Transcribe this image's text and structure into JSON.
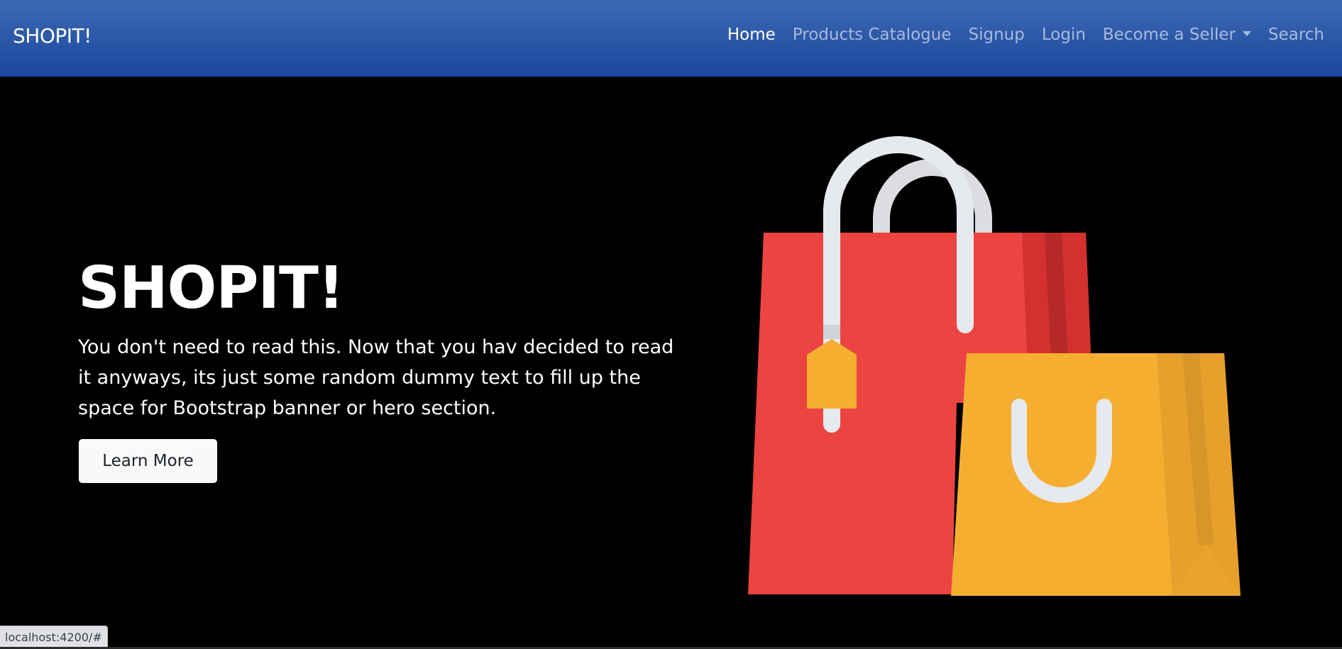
{
  "navbar": {
    "brand": "SHOPIT!",
    "links": [
      {
        "label": "Home",
        "active": true
      },
      {
        "label": "Products Catalogue",
        "active": false
      },
      {
        "label": "Signup",
        "active": false
      },
      {
        "label": "Login",
        "active": false
      },
      {
        "label": "Become a Seller",
        "active": false,
        "dropdown": true
      },
      {
        "label": "Search",
        "active": false
      }
    ]
  },
  "hero": {
    "title": "SHOPIT!",
    "text": "You don't need to read this. Now that you hav decided to read it anyways, its just some random dummy text to fill up the space for Bootstrap banner or hero section.",
    "button_label": "Learn More",
    "illustration_icon": "shopping-bags-icon"
  },
  "status_bar": {
    "url": "localhost:4200/#"
  },
  "colors": {
    "navbar_top": "#3d69b4",
    "navbar_bottom": "#1a47a0",
    "hero_background": "#000000",
    "red_bag": "#ec4441",
    "yellow_bag": "#f6ae31",
    "handle": "#e6e9ee"
  }
}
